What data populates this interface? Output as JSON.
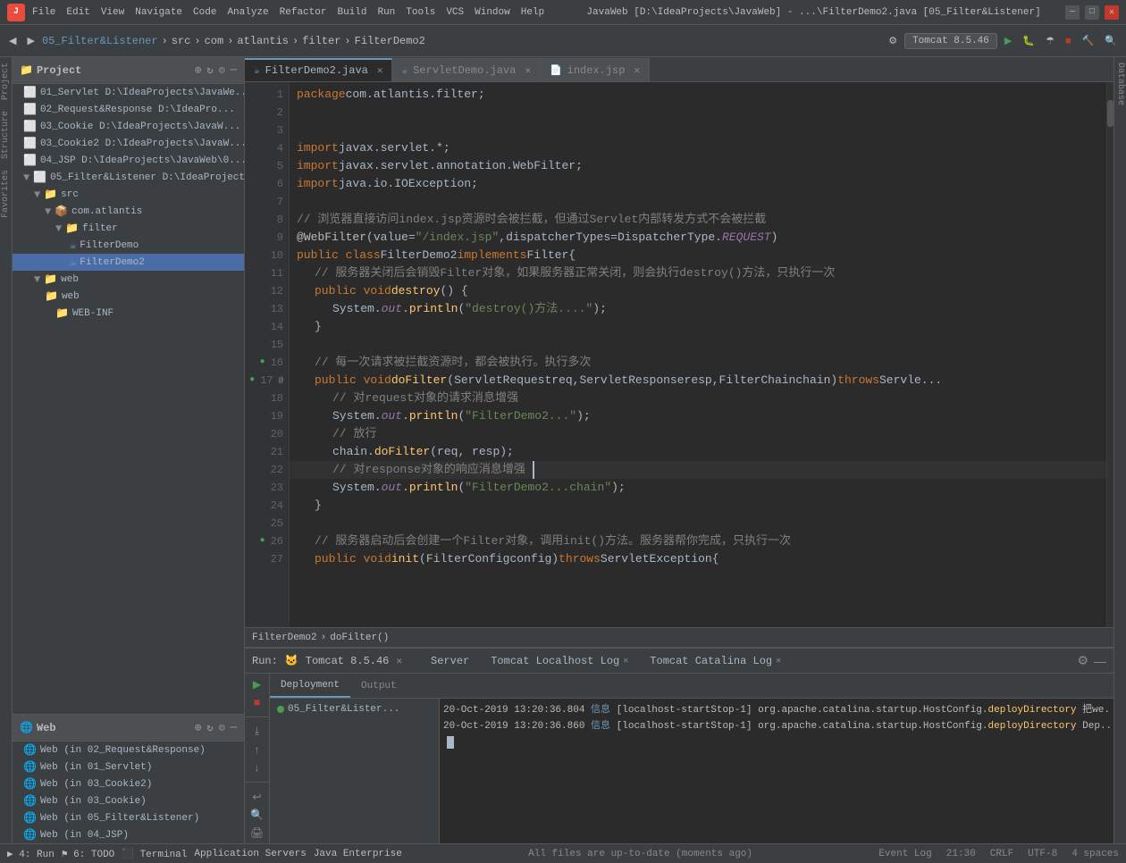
{
  "titlebar": {
    "logo": "J",
    "menu": [
      "File",
      "Edit",
      "View",
      "Navigate",
      "Code",
      "Analyze",
      "Refactor",
      "Build",
      "Run",
      "Tools",
      "VCS",
      "Window",
      "Help"
    ],
    "title": "JavaWeb [D:\\IdeaProjects\\JavaWeb] - ...\\FilterDemo2.java [05_Filter&Listener]"
  },
  "toolbar": {
    "breadcrumb": [
      "05_Filter&Listener",
      "src",
      "com",
      "atlantis",
      "filter",
      "FilterDemo2"
    ],
    "run_config": "Tomcat 8.5.46"
  },
  "tabs": [
    {
      "label": "FilterDemo2.java",
      "type": "java",
      "active": true
    },
    {
      "label": "ServletDemo.java",
      "type": "java",
      "active": false
    },
    {
      "label": "index.jsp",
      "type": "jsp",
      "active": false
    }
  ],
  "project_panel": {
    "title": "Project",
    "items": [
      {
        "label": "01_Servlet D:\\IdeaProjects\\JavaWe...",
        "indent": 1,
        "type": "module"
      },
      {
        "label": "02_Request&Response D:\\IdeaPro...",
        "indent": 1,
        "type": "module"
      },
      {
        "label": "03_Cookie D:\\IdeaProjects\\JavaW...",
        "indent": 1,
        "type": "module"
      },
      {
        "label": "03_Cookie2 D:\\IdeaProjects\\JavaW...",
        "indent": 1,
        "type": "module"
      },
      {
        "label": "04_JSP D:\\IdeaProjects\\JavaWeb\\0...",
        "indent": 1,
        "type": "module"
      },
      {
        "label": "05_Filter&Listener D:\\IdeaProjects...",
        "indent": 1,
        "type": "module",
        "expanded": true
      },
      {
        "label": "src",
        "indent": 2,
        "type": "folder",
        "expanded": true
      },
      {
        "label": "com.atlantis",
        "indent": 3,
        "type": "package",
        "expanded": true
      },
      {
        "label": "filter",
        "indent": 4,
        "type": "folder",
        "expanded": true
      },
      {
        "label": "FilterDemo",
        "indent": 5,
        "type": "java"
      },
      {
        "label": "FilterDemo2",
        "indent": 5,
        "type": "java",
        "selected": true
      },
      {
        "label": "web",
        "indent": 2,
        "type": "folder",
        "expanded": true
      },
      {
        "label": "web",
        "indent": 3,
        "type": "folder"
      },
      {
        "label": "WEB-INF",
        "indent": 4,
        "type": "folder"
      }
    ]
  },
  "web_panel": {
    "title": "Web",
    "items": [
      {
        "label": "Web (in 02_Request&Response)",
        "indent": 1,
        "type": "web"
      },
      {
        "label": "Web (in 01_Servlet)",
        "indent": 1,
        "type": "web"
      },
      {
        "label": "Web (in 03_Cookie2)",
        "indent": 1,
        "type": "web"
      },
      {
        "label": "Web (in 03_Cookie)",
        "indent": 1,
        "type": "web"
      },
      {
        "label": "Web (in 05_Filter&Listener)",
        "indent": 1,
        "type": "web"
      },
      {
        "label": "Web (in 04_JSP)",
        "indent": 1,
        "type": "web"
      }
    ]
  },
  "code": {
    "lines": [
      {
        "num": 1,
        "text": "    package com.atlantis.filter;"
      },
      {
        "num": 2,
        "text": ""
      },
      {
        "num": 3,
        "text": ""
      },
      {
        "num": 4,
        "text": "    import javax.servlet.*;"
      },
      {
        "num": 5,
        "text": "    import javax.servlet.annotation.WebFilter;"
      },
      {
        "num": 6,
        "text": "    import java.io.IOException;"
      },
      {
        "num": 7,
        "text": ""
      },
      {
        "num": 8,
        "text": "    // 浏览器直接访问index.jsp资源时会被拦截，但通过Servlet内部转发方式不会被拦截"
      },
      {
        "num": 9,
        "text": "    @WebFilter(value = \"/index.jsp\",dispatcherTypes =DispatcherType.REQUEST)"
      },
      {
        "num": 10,
        "text": "    public class FilterDemo2 implements Filter {"
      },
      {
        "num": 11,
        "text": "        // 服务器关闭后会销毁Filter对象，如果服务器正常关闭，则会执行destroy()方法，只执行一次"
      },
      {
        "num": 12,
        "text": "        public void destroy() {"
      },
      {
        "num": 13,
        "text": "            System.out.println(\"destroy()方法....\");"
      },
      {
        "num": 14,
        "text": "        }"
      },
      {
        "num": 15,
        "text": ""
      },
      {
        "num": 16,
        "text": "        // 每一次请求被拦截资源时，都会被执行。执行多次"
      },
      {
        "num": 17,
        "text": "        public void doFilter(ServletRequest req, ServletResponse resp, FilterChain chain) throws Servle..."
      },
      {
        "num": 18,
        "text": "            // 对request对象的请求消息增强"
      },
      {
        "num": 19,
        "text": "            System.out.println(\"FilterDemo2...\");"
      },
      {
        "num": 20,
        "text": "            // 放行"
      },
      {
        "num": 21,
        "text": "            chain.doFilter(req, resp);"
      },
      {
        "num": 22,
        "text": "            // 对response对象的响应消息增强"
      },
      {
        "num": 23,
        "text": "            System.out.println(\"FilterDemo2...chain\");"
      },
      {
        "num": 24,
        "text": "        }"
      },
      {
        "num": 25,
        "text": ""
      },
      {
        "num": 26,
        "text": "        // 服务器启动后会创建一个Filter对象，调用init()方法。服务器帮你完成，只执行一次"
      },
      {
        "num": 27,
        "text": "        public void init(FilterConfig config) throws ServletException {"
      }
    ]
  },
  "breadcrumb_bar": {
    "class": "FilterDemo2",
    "method": "doFilter()"
  },
  "bottom_panel": {
    "run_label": "Run:",
    "tomcat_label": "Tomcat 8.5.46",
    "tabs": [
      {
        "label": "Server",
        "active": false
      },
      {
        "label": "Tomcat Localhost Log",
        "active": false
      },
      {
        "label": "Tomcat Catalina Log",
        "active": false
      }
    ],
    "deployment_tab": "Deployment",
    "output_tab": "Output",
    "deploy_items": [
      {
        "label": "05_Filter&Lister...",
        "status": "green"
      }
    ],
    "log_lines": [
      {
        "text": "20-Oct-2019 13:20:36.804 信息 [localhost-startStop-1] org.apache.catalina.startup.HostConfig.deployDirectory 把we..."
      },
      {
        "text": "20-Oct-2019 13:20:36.860 信息 [localhost-startStop-1] org.apache.catalina.startup.HostConfig.deployDirectory Dep..."
      }
    ]
  },
  "statusbar": {
    "message": "All files are up-to-date (moments ago)",
    "run_label": "4: Run",
    "todo_label": "6: TODO",
    "terminal_label": "Terminal",
    "app_servers_label": "Application Servers",
    "java_enterprise_label": "Java Enterprise",
    "event_log_label": "Event Log",
    "time": "21:30",
    "encoding": "CRLF",
    "charset": "UTF-8",
    "indent": "4 spaces"
  }
}
